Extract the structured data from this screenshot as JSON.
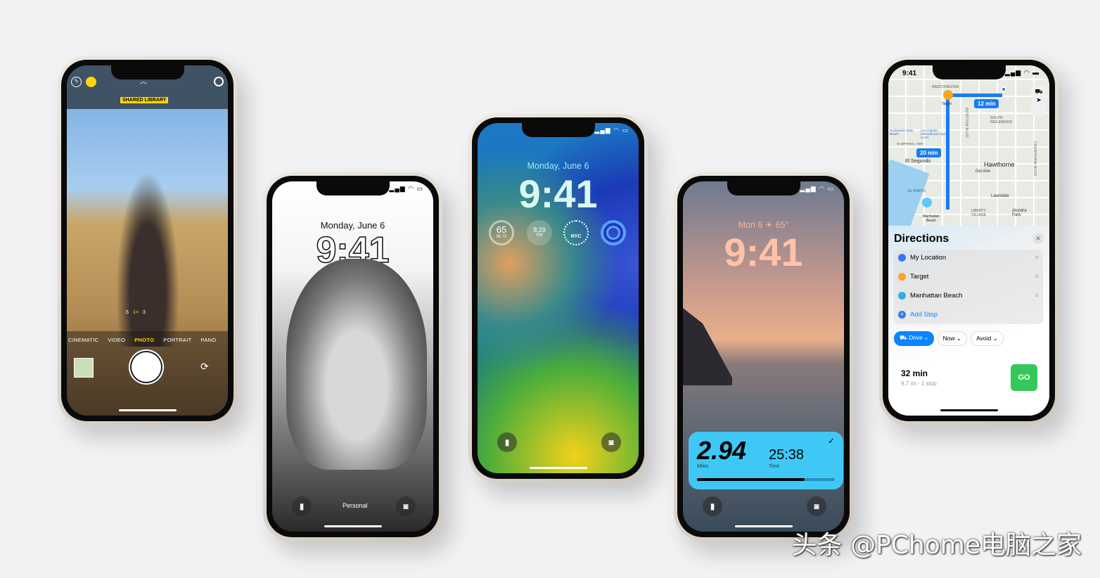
{
  "camera": {
    "shared_library": "SHARED LIBRARY",
    "zoom": [
      ".5",
      "1×",
      "3"
    ],
    "modes": [
      "CINEMATIC",
      "VIDEO",
      "PHOTO",
      "PORTRAIT",
      "PANO"
    ],
    "active_mode": "PHOTO",
    "accent": "#ffd60a"
  },
  "lock_bw": {
    "date": "Monday, June 6",
    "time": "9:41",
    "focus": "Personal"
  },
  "lock_color": {
    "date": "Monday, June 6",
    "time": "9:41",
    "temp": "65",
    "temp_range": "55  72",
    "sunset": "8:29",
    "sunset_ampm": "PM",
    "clock_city": "NYC"
  },
  "lock_sunset": {
    "date": "Mon 6 ☀ 65°",
    "time": "9:41",
    "distance": "2.94",
    "distance_label": "Miles",
    "elapsed": "25:38",
    "elapsed_label": "Time",
    "progress": 0.78,
    "widget_color": "#3fc8f5"
  },
  "maps": {
    "status_time": "9:41",
    "map_labels": [
      "WESTCHESTER",
      "Target",
      "SOUTH INGLEWOOD",
      "Los Angeles International Airport (LAX)",
      "Dockweiler State Beach",
      "W IMPERIAL HWY",
      "El Segundo",
      "Hawthorne",
      "Del Aire",
      "EL PORTO",
      "Lawndale",
      "LIBERTY VILLAGE",
      "Alondra Park",
      "Manhattan Beach",
      "AVIATION BLVD",
      "CRENSHAW BLVD"
    ],
    "eta_badges": [
      "12 min",
      "20 min"
    ],
    "title": "Directions",
    "stops": [
      "My Location",
      "Target",
      "Manhattan Beach"
    ],
    "add_stop": "Add Stop",
    "options": [
      "Drive",
      "Now",
      "Avoid"
    ],
    "duration": "32 min",
    "details": "9.7 mi · 1 stop",
    "go": "GO",
    "accent": "#0a84ff",
    "go_color": "#34c759"
  },
  "watermark": "头条 @PChome电脑之家"
}
